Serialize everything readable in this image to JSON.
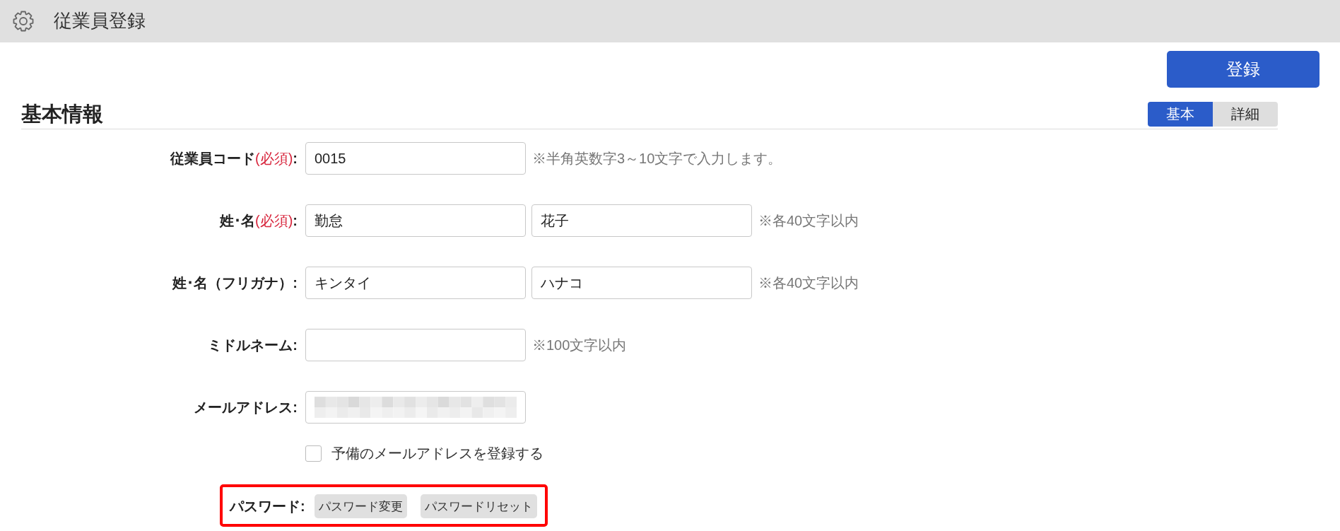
{
  "header": {
    "title": "従業員登録"
  },
  "toolbar": {
    "register_button": "登録"
  },
  "section": {
    "title": "基本情報",
    "tabs": [
      {
        "label": "基本",
        "selected": true
      },
      {
        "label": "詳細",
        "selected": false
      }
    ]
  },
  "fields": [
    {
      "label": "従業員コード",
      "required_mark": "(必須)",
      "colon": ":",
      "inputs": [
        {
          "kind": "text",
          "value": "0015"
        }
      ],
      "hint": "※半角英数字3～10文字で入力します。"
    },
    {
      "label": "姓･名",
      "required_mark": "(必須)",
      "colon": ":",
      "inputs": [
        {
          "kind": "text",
          "value": "勤怠"
        },
        {
          "kind": "text",
          "value": "花子"
        }
      ],
      "hint": "※各40文字以内"
    },
    {
      "label": "姓･名（フリガナ）",
      "colon": ":",
      "inputs": [
        {
          "kind": "text",
          "value": "キンタイ"
        },
        {
          "kind": "text",
          "value": "ハナコ"
        }
      ],
      "hint": "※各40文字以内"
    },
    {
      "label": "ミドルネーム",
      "colon": ":",
      "inputs": [
        {
          "kind": "text"
        }
      ],
      "hint": "※100文字以内"
    },
    {
      "label": "メールアドレス",
      "colon": ":",
      "inputs": [
        {
          "kind": "redacted"
        }
      ]
    }
  ],
  "spare_email_option": {
    "label": "予備のメールアドレスを登録する",
    "checked": false
  },
  "password": {
    "label": "パスワード",
    "colon": ":",
    "buttons": [
      "パスワード変更",
      "パスワードリセット"
    ],
    "highlighted": true
  }
}
